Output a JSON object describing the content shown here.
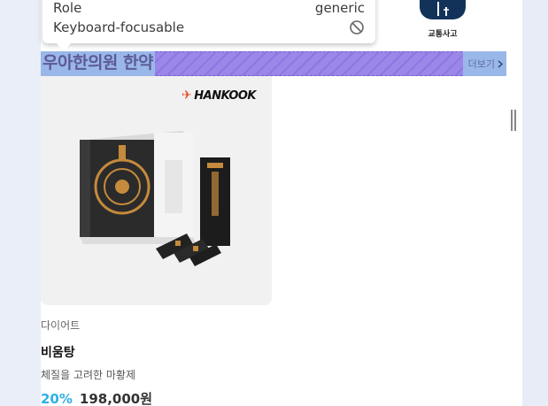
{
  "tooltip": {
    "rows": [
      {
        "label": "Role",
        "value": "generic"
      },
      {
        "label": "Keyboard-focusable",
        "value_icon": "not-allowed-icon"
      }
    ]
  },
  "category": {
    "label": "교통사고",
    "icon": "traffic-icon",
    "color": "#13325a"
  },
  "section": {
    "title": "우아한의원 한약",
    "more_label": "더보기"
  },
  "product": {
    "brand": "HANKOOK",
    "category": "다이어트",
    "name": "비움탕",
    "description": "체질을 고려한 마황제",
    "discount": "20%",
    "price": "198,000원"
  },
  "colors": {
    "highlight": "#9a87e8",
    "accent": "#2fb0e6"
  }
}
